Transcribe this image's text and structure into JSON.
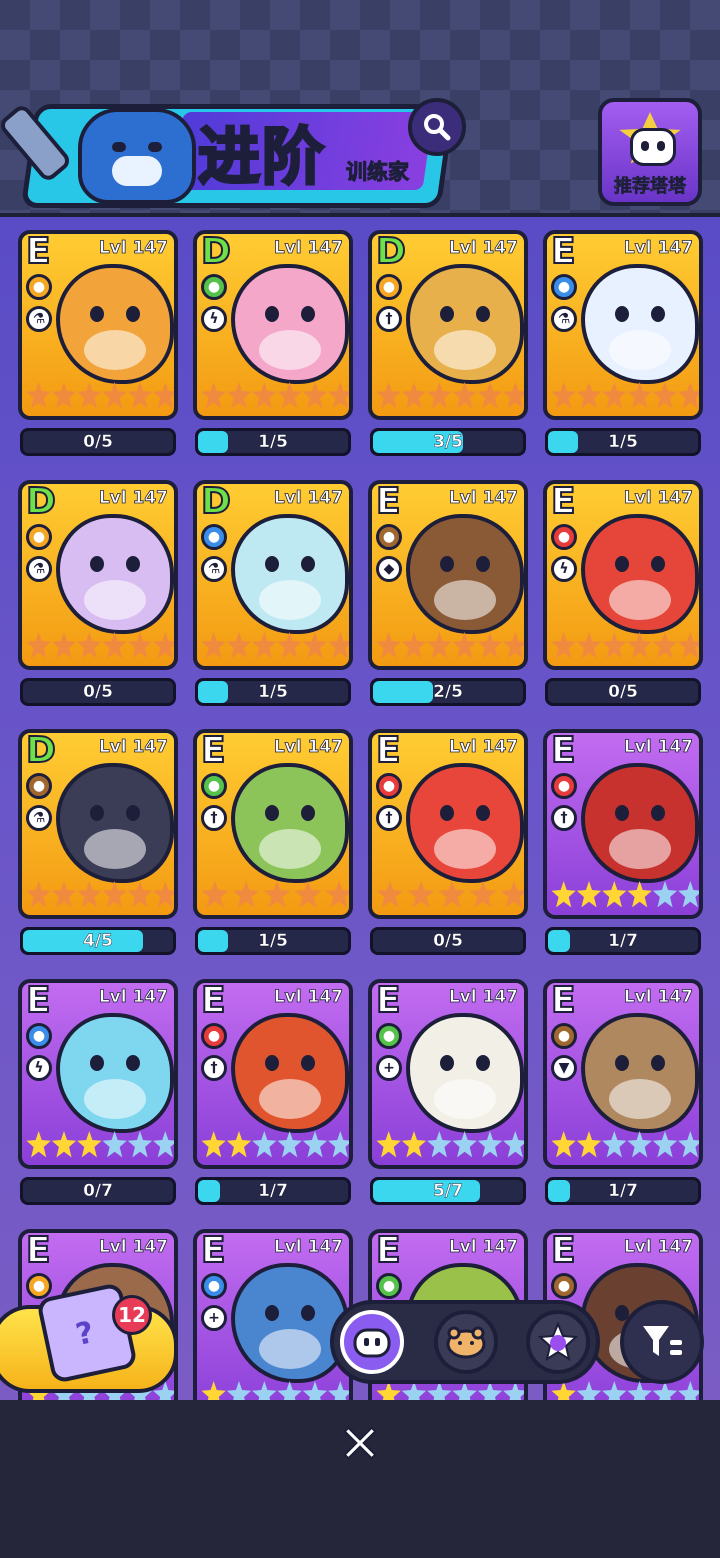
{
  "header": {
    "title": "进阶",
    "subtitle": "训练家",
    "recommend_label": "推荐塔塔"
  },
  "cards": [
    {
      "grade": "E",
      "level": "Lvl 147",
      "frame": "gold",
      "element": "electric",
      "element_color": "#f5a623",
      "class_icon": "flask",
      "creature_color": "#f2a43a",
      "stars": [
        "bronze",
        "bronze",
        "bronze",
        "bronze",
        "bronze",
        "bronze"
      ],
      "progress_text": "0/5",
      "progress": 0.0
    },
    {
      "grade": "D",
      "level": "Lvl 147",
      "frame": "gold",
      "element": "grass",
      "element_color": "#55c24a",
      "class_icon": "bolt",
      "creature_color": "#f4a7c8",
      "stars": [
        "bronze",
        "bronze",
        "bronze",
        "bronze",
        "bronze",
        "bronze"
      ],
      "progress_text": "1/5",
      "progress": 0.2
    },
    {
      "grade": "D",
      "level": "Lvl 147",
      "frame": "gold",
      "element": "electric",
      "element_color": "#f5a623",
      "class_icon": "sword",
      "creature_color": "#e8b04a",
      "stars": [
        "bronze",
        "bronze",
        "bronze",
        "bronze",
        "bronze",
        "bronze"
      ],
      "progress_text": "3/5",
      "progress": 0.6
    },
    {
      "grade": "E",
      "level": "Lvl 147",
      "frame": "gold",
      "element": "water",
      "element_color": "#3a8de8",
      "class_icon": "flask",
      "creature_color": "#e8f1ff",
      "stars": [
        "bronze",
        "bronze",
        "bronze",
        "bronze",
        "bronze",
        "bronze"
      ],
      "progress_text": "1/5",
      "progress": 0.2
    },
    {
      "grade": "D",
      "level": "Lvl 147",
      "frame": "gold",
      "element": "electric",
      "element_color": "#f5a623",
      "class_icon": "flask",
      "creature_color": "#d8bdf2",
      "stars": [
        "bronze",
        "bronze",
        "bronze",
        "bronze",
        "bronze",
        "bronze"
      ],
      "progress_text": "0/5",
      "progress": 0.0
    },
    {
      "grade": "D",
      "level": "Lvl 147",
      "frame": "gold",
      "element": "water",
      "element_color": "#3a8de8",
      "class_icon": "flask",
      "creature_color": "#bfe9f2",
      "stars": [
        "bronze",
        "bronze",
        "bronze",
        "bronze",
        "bronze",
        "bronze"
      ],
      "progress_text": "1/5",
      "progress": 0.2
    },
    {
      "grade": "E",
      "level": "Lvl 147",
      "frame": "gold",
      "element": "earth",
      "element_color": "#a0672f",
      "class_icon": "eye",
      "creature_color": "#8a5a36",
      "stars": [
        "bronze",
        "bronze",
        "bronze",
        "bronze",
        "bronze",
        "bronze"
      ],
      "progress_text": "2/5",
      "progress": 0.4
    },
    {
      "grade": "E",
      "level": "Lvl 147",
      "frame": "gold",
      "element": "fire",
      "element_color": "#e83b3b",
      "class_icon": "bolt",
      "creature_color": "#e6463a",
      "stars": [
        "bronze",
        "bronze",
        "bronze",
        "bronze",
        "bronze",
        "bronze"
      ],
      "progress_text": "0/5",
      "progress": 0.0
    },
    {
      "grade": "D",
      "level": "Lvl 147",
      "frame": "gold",
      "element": "earth",
      "element_color": "#a0672f",
      "class_icon": "flask",
      "creature_color": "#3a3d55",
      "stars": [
        "bronze",
        "bronze",
        "bronze",
        "bronze",
        "bronze",
        "bronze"
      ],
      "progress_text": "4/5",
      "progress": 0.8
    },
    {
      "grade": "E",
      "level": "Lvl 147",
      "frame": "gold",
      "element": "grass",
      "element_color": "#55c24a",
      "class_icon": "sword",
      "creature_color": "#8cc45a",
      "stars": [
        "bronze",
        "bronze",
        "bronze",
        "bronze",
        "bronze"
      ],
      "progress_text": "1/5",
      "progress": 0.2
    },
    {
      "grade": "E",
      "level": "Lvl 147",
      "frame": "gold",
      "element": "fire",
      "element_color": "#e83b3b",
      "class_icon": "sword",
      "creature_color": "#e8463a",
      "stars": [
        "bronze",
        "bronze",
        "bronze",
        "bronze",
        "bronze"
      ],
      "progress_text": "0/5",
      "progress": 0.0
    },
    {
      "grade": "E",
      "level": "Lvl 147",
      "frame": "purple",
      "element": "fire",
      "element_color": "#e83b3b",
      "class_icon": "sword",
      "creature_color": "#c8322e",
      "stars": [
        "gold",
        "gold",
        "gold",
        "gold",
        "silver",
        "silver"
      ],
      "progress_text": "1/7",
      "progress": 0.14
    },
    {
      "grade": "E",
      "level": "Lvl 147",
      "frame": "purple",
      "element": "water",
      "element_color": "#3a8de8",
      "class_icon": "bolt",
      "creature_color": "#7fd7ef",
      "stars": [
        "gold",
        "gold",
        "gold",
        "silver",
        "silver",
        "silver"
      ],
      "progress_text": "0/7",
      "progress": 0.0
    },
    {
      "grade": "E",
      "level": "Lvl 147",
      "frame": "purple",
      "element": "fire",
      "element_color": "#e83b3b",
      "class_icon": "sword",
      "creature_color": "#e0552e",
      "stars": [
        "gold",
        "gold",
        "silver",
        "silver",
        "silver",
        "silver"
      ],
      "progress_text": "1/7",
      "progress": 0.14
    },
    {
      "grade": "E",
      "level": "Lvl 147",
      "frame": "purple",
      "element": "grass",
      "element_color": "#55c24a",
      "class_icon": "plus",
      "creature_color": "#f2f0e6",
      "stars": [
        "gold",
        "gold",
        "silver",
        "silver",
        "silver",
        "silver"
      ],
      "progress_text": "5/7",
      "progress": 0.71
    },
    {
      "grade": "E",
      "level": "Lvl 147",
      "frame": "purple",
      "element": "earth",
      "element_color": "#a0672f",
      "class_icon": "shield",
      "creature_color": "#b08860",
      "stars": [
        "gold",
        "gold",
        "silver",
        "silver",
        "silver",
        "silver"
      ],
      "progress_text": "1/7",
      "progress": 0.14
    },
    {
      "grade": "E",
      "level": "Lvl 147",
      "frame": "purple",
      "element": "electric",
      "element_color": "#f5a623",
      "class_icon": "",
      "creature_color": "#9a6a4a",
      "stars": [
        "gold",
        "silver",
        "silver",
        "silver",
        "silver",
        "silver"
      ],
      "progress_text": "",
      "progress": 0.0
    },
    {
      "grade": "E",
      "level": "Lvl 147",
      "frame": "purple",
      "element": "water",
      "element_color": "#3a8de8",
      "class_icon": "plus",
      "creature_color": "#4a86d0",
      "stars": [
        "gold",
        "silver",
        "silver",
        "silver",
        "silver",
        "silver"
      ],
      "progress_text": "",
      "progress": 0.0
    },
    {
      "grade": "E",
      "level": "Lvl 147",
      "frame": "purple",
      "element": "grass",
      "element_color": "#55c24a",
      "class_icon": "",
      "creature_color": "#9ac24a",
      "stars": [
        "gold",
        "silver",
        "silver",
        "silver",
        "silver",
        "silver"
      ],
      "progress_text": "",
      "progress": 0.0
    },
    {
      "grade": "E",
      "level": "Lvl 147",
      "frame": "purple",
      "element": "earth",
      "element_color": "#a0672f",
      "class_icon": "",
      "creature_color": "#6a4030",
      "stars": [
        "gold",
        "silver",
        "silver",
        "silver",
        "silver",
        "silver"
      ],
      "progress_text": "",
      "progress": 0.0
    }
  ],
  "bottom": {
    "box_count": "12",
    "tabs": [
      {
        "name": "robot-tab",
        "icon": "robot-icon",
        "active": true
      },
      {
        "name": "creature-tab",
        "icon": "creature-icon",
        "active": false
      },
      {
        "name": "star-tab",
        "icon": "star-badge-icon",
        "active": false
      }
    ],
    "close_label": "✕"
  }
}
